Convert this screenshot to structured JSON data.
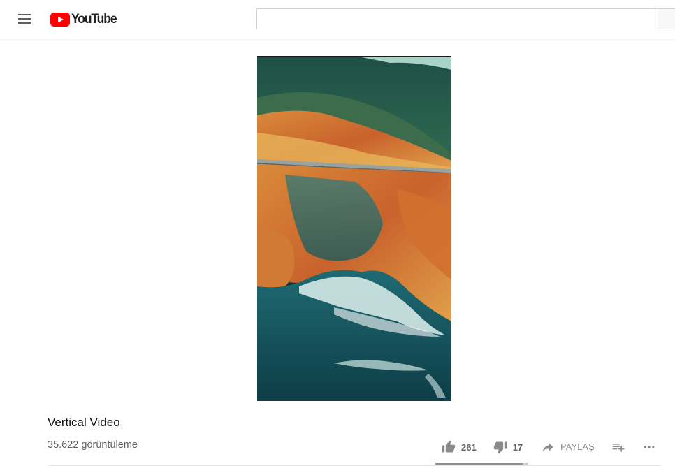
{
  "header": {
    "logo_text": "YouTube",
    "search": {
      "value": "",
      "placeholder": ""
    }
  },
  "video": {
    "title": "Vertical Video",
    "views": "35.622 görüntüleme",
    "likes": "261",
    "dislikes": "17",
    "share_label": "PAYLAŞ",
    "like_ratio": 0.94
  },
  "icons": {
    "menu": "menu-icon",
    "logo": "youtube-logo-icon",
    "like": "thumb-up-icon",
    "dislike": "thumb-down-icon",
    "share": "share-icon",
    "add_to_playlist": "playlist-add-icon",
    "more": "more-horiz-icon"
  },
  "colors": {
    "brand_red": "#ff0000",
    "icon_gray": "#8a8a8a",
    "text_secondary": "#606060"
  }
}
